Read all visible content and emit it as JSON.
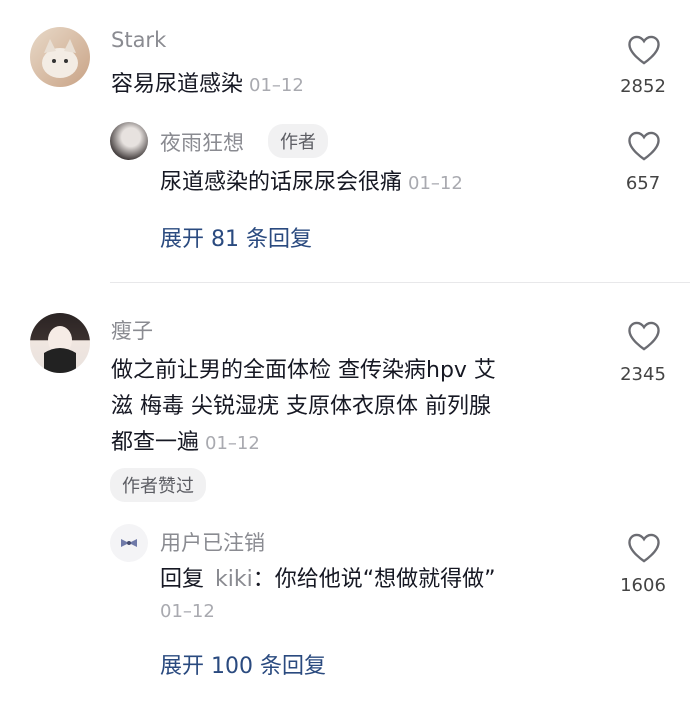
{
  "colors": {
    "accent_link": "#2a4a7f",
    "muted": "#8a8b91",
    "badge_bg": "#f1f1f2"
  },
  "comment1": {
    "username": "Stark",
    "text": "容易尿道感染",
    "time": "01–12",
    "like_count": "2852",
    "reply": {
      "username": "夜雨狂想",
      "badge": "作者",
      "text": "尿道感染的话尿尿会很痛",
      "time": "01–12",
      "like_count": "657"
    },
    "expand_label": "展开 81 条回复"
  },
  "comment2": {
    "username": "瘦子",
    "text_lines": [
      "做之前让男的全面体检 查传染病hpv 艾",
      "滋 梅毒 尖锐湿疣 支原体衣原体 前列腺",
      "都查一遍"
    ],
    "time": "01–12",
    "like_count": "2345",
    "author_liked_badge": "作者赞过",
    "reply": {
      "username": "用户已注销",
      "reply_prefix": "回复",
      "reply_to": "kiki",
      "text": "：你给他说“想做就得做”",
      "time": "01–12",
      "like_count": "1606"
    },
    "expand_label": "展开 100 条回复"
  },
  "icons": {
    "like": "heart-outline-icon"
  }
}
